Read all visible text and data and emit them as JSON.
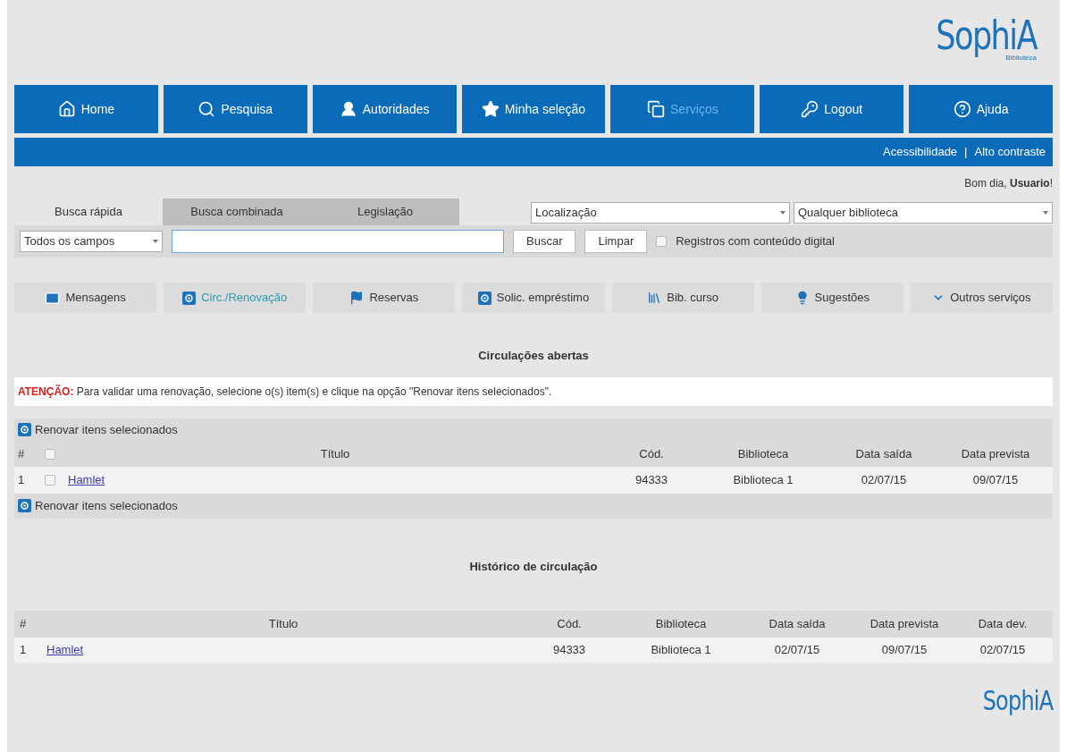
{
  "logo": {
    "name": "SophiA",
    "subtitle": "Biblioteca"
  },
  "nav": [
    {
      "label": "Home",
      "selected": false
    },
    {
      "label": "Pesquisa",
      "selected": false
    },
    {
      "label": "Autoridades",
      "selected": false
    },
    {
      "label": "Minha seleção",
      "selected": false
    },
    {
      "label": "Serviços",
      "selected": true
    },
    {
      "label": "Logout",
      "selected": false
    },
    {
      "label": "Ajuda",
      "selected": false
    }
  ],
  "links": [
    "Acessibilidade",
    "|",
    "Alto contraste"
  ],
  "greeting": {
    "text": "Bom dia, ",
    "user": "Usuario",
    "suffix": "!"
  },
  "search_tabs": [
    {
      "label": "Busca rápida",
      "selected": true
    },
    {
      "label": "Busca combinada",
      "selected": false
    },
    {
      "label": "Legislação",
      "selected": false
    }
  ],
  "location_select": "Localização",
  "library_select": "Qualquer biblioteca",
  "field_select": "Todos os campos",
  "search_buttons": [
    "Buscar",
    "Limpar"
  ],
  "digital_filter": {
    "label": "Registros com conteúdo digital",
    "checked": false
  },
  "service_tabs": [
    {
      "label": "Mensagens",
      "selected": false
    },
    {
      "label": "Circ./Renovação",
      "selected": true
    },
    {
      "label": "Reservas",
      "selected": false
    },
    {
      "label": "Solic. empréstimo",
      "selected": false
    },
    {
      "label": "Bib. curso",
      "selected": false
    },
    {
      "label": "Sugestões",
      "selected": false
    },
    {
      "label": "Outros serviços",
      "selected": false
    }
  ],
  "open_section": {
    "title": "Circulações abertas",
    "notice": "**ATENÇÃO:** Para validar uma renovação, selecione o(s) item(s) e clique na opção \"Renovar itens selecionados\".",
    "action": "Renovar itens selecionados",
    "select_all": false,
    "columns": [
      "#",
      "Título",
      "Cód.",
      "Biblioteca",
      "Data saída",
      "Data prevista"
    ],
    "rows": [
      {
        "n": "1",
        "checked": false,
        "title": "Hamlet",
        "code": "94333",
        "library": "Biblioteca 1",
        "out": "02/07/15",
        "due": "09/07/15"
      }
    ],
    "action_bottom": "Renovar itens selecionados"
  },
  "history_section": {
    "title": "Histórico de circulação",
    "columns": [
      "#",
      "Título",
      "Cód.",
      "Biblioteca",
      "Data saída",
      "Data prevista",
      "Data dev."
    ],
    "rows": [
      {
        "n": "1",
        "title": "Hamlet",
        "code": "94333",
        "library": "Biblioteca 1",
        "out": "02/07/15",
        "due": "09/07/15",
        "returned": "02/07/15"
      }
    ]
  },
  "footer_logo": "SophiA"
}
